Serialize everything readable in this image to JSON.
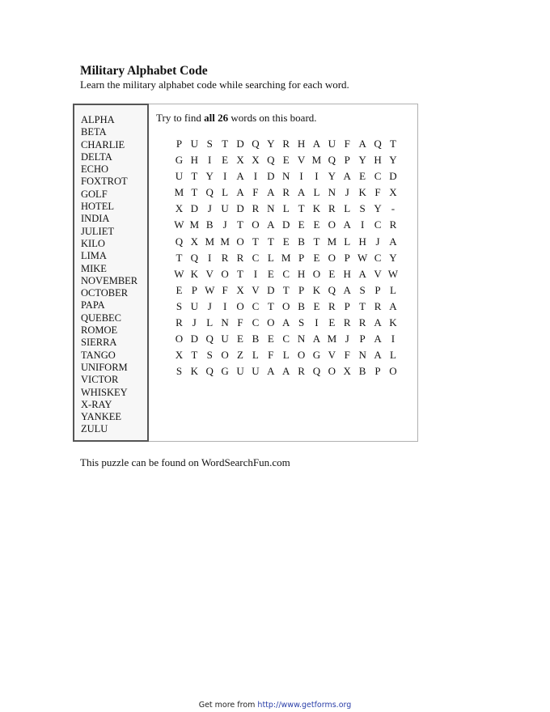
{
  "header": {
    "title": "Military Alphabet Code",
    "subtitle": "Learn the military alphabet code while searching for each word."
  },
  "word_list": [
    "ALPHA",
    "BETA",
    "CHARLIE",
    "DELTA",
    "ECHO",
    "FOXTROT",
    "GOLF",
    "HOTEL",
    "INDIA",
    "JULIET",
    "KILO",
    "LIMA",
    "MIKE",
    "NOVEMBER",
    "OCTOBER",
    "PAPA",
    "QUEBEC",
    "ROMOE",
    "SIERRA",
    "TANGO",
    "UNIFORM",
    "VICTOR",
    "WHISKEY",
    "X-RAY",
    "YANKEE",
    "ZULU"
  ],
  "instructions": {
    "prefix": "Try to find ",
    "bold": "all 26",
    "suffix": " words on this board."
  },
  "grid": [
    [
      "P",
      "U",
      "S",
      "T",
      "D",
      "Q",
      "Y",
      "R",
      "H",
      "A",
      "U",
      "F",
      "A",
      "Q",
      "T"
    ],
    [
      "G",
      "H",
      "I",
      "E",
      "X",
      "X",
      "Q",
      "E",
      "V",
      "M",
      "Q",
      "P",
      "Y",
      "H",
      "Y"
    ],
    [
      "U",
      "T",
      "Y",
      "I",
      "A",
      "I",
      "D",
      "N",
      "I",
      "I",
      "Y",
      "A",
      "E",
      "C",
      "D"
    ],
    [
      "M",
      "T",
      "Q",
      "L",
      "A",
      "F",
      "A",
      "R",
      "A",
      "L",
      "N",
      "J",
      "K",
      "F",
      "X"
    ],
    [
      "X",
      "D",
      "J",
      "U",
      "D",
      "R",
      "N",
      "L",
      "T",
      "K",
      "R",
      "L",
      "S",
      "Y",
      "-"
    ],
    [
      "W",
      "M",
      "B",
      "J",
      "T",
      "O",
      "A",
      "D",
      "E",
      "E",
      "O",
      "A",
      "I",
      "C",
      "R"
    ],
    [
      "Q",
      "X",
      "M",
      "M",
      "O",
      "T",
      "T",
      "E",
      "B",
      "T",
      "M",
      "L",
      "H",
      "J",
      "A"
    ],
    [
      "T",
      "Q",
      "I",
      "R",
      "R",
      "C",
      "L",
      "M",
      "P",
      "E",
      "O",
      "P",
      "W",
      "C",
      "Y"
    ],
    [
      "W",
      "K",
      "V",
      "O",
      "T",
      "I",
      "E",
      "C",
      "H",
      "O",
      "E",
      "H",
      "A",
      "V",
      "W"
    ],
    [
      "E",
      "P",
      "W",
      "F",
      "X",
      "V",
      "D",
      "T",
      "P",
      "K",
      "Q",
      "A",
      "S",
      "P",
      "L"
    ],
    [
      "S",
      "U",
      "J",
      "I",
      "O",
      "C",
      "T",
      "O",
      "B",
      "E",
      "R",
      "P",
      "T",
      "R",
      "A"
    ],
    [
      "R",
      "J",
      "L",
      "N",
      "F",
      "C",
      "O",
      "A",
      "S",
      "I",
      "E",
      "R",
      "R",
      "A",
      "K"
    ],
    [
      "O",
      "D",
      "Q",
      "U",
      "E",
      "B",
      "E",
      "C",
      "N",
      "A",
      "M",
      "J",
      "P",
      "A",
      "I"
    ],
    [
      "X",
      "T",
      "S",
      "O",
      "Z",
      "L",
      "F",
      "L",
      "O",
      "G",
      "V",
      "F",
      "N",
      "A",
      "L"
    ],
    [
      "S",
      "K",
      "Q",
      "G",
      "U",
      "U",
      "A",
      "A",
      "R",
      "Q",
      "O",
      "X",
      "B",
      "P",
      "O"
    ]
  ],
  "source_note": "This puzzle can be found on WordSearchFun.com",
  "footer": {
    "prefix": "Get more from ",
    "link": "http://www.getforms.org"
  }
}
